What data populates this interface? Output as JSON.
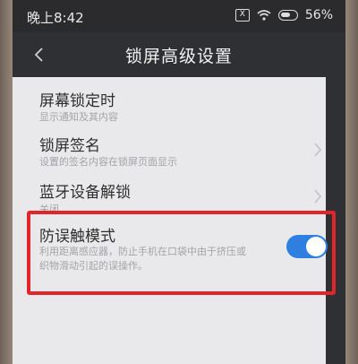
{
  "status_bar": {
    "time": "晚上8:42",
    "sim_icon_text": "X",
    "battery_percent": "56%"
  },
  "header": {
    "title": "锁屏高级设置"
  },
  "settings": [
    {
      "title": "屏幕锁定时",
      "subtitle": "显示通知及其内容"
    },
    {
      "title": "锁屏签名",
      "subtitle": "设置的签名内容在锁屏页面显示"
    },
    {
      "title": "蓝牙设备解锁",
      "subtitle": "关闭"
    },
    {
      "title": "防误触模式",
      "subtitle_line1": "利用距离感应器，防止手机在口袋中由于挤压或",
      "subtitle_line2": "织物滑动引起的误操作。",
      "enabled": true
    }
  ],
  "colors": {
    "highlight": "#e2252a",
    "toggle_on": "#2f7fe0"
  }
}
